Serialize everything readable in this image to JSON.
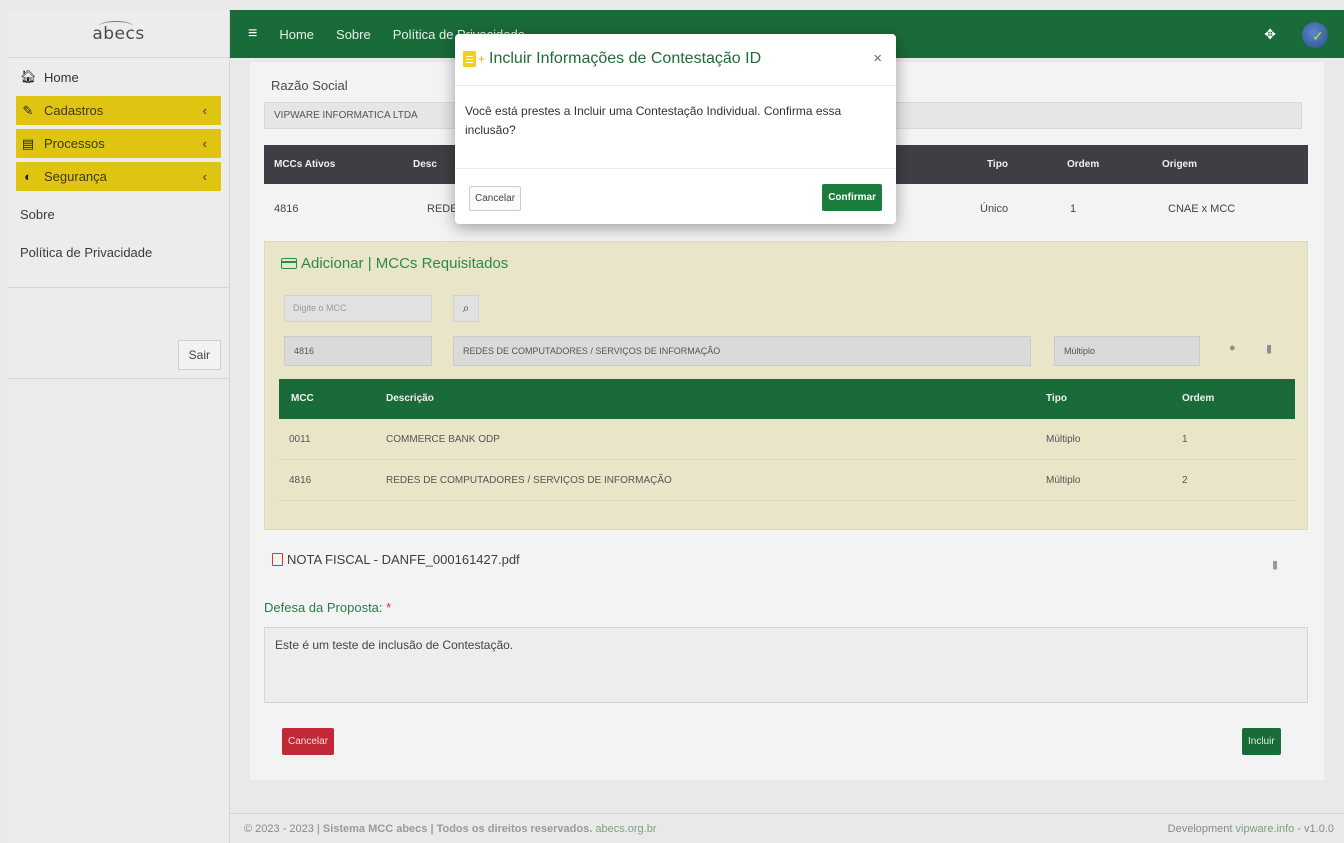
{
  "sidebar": {
    "brand": "abecs",
    "home": "Home",
    "menus": [
      {
        "label": "Cadastros"
      },
      {
        "label": "Processos"
      },
      {
        "label": "Segurança"
      }
    ],
    "sobre": "Sobre",
    "privacidade": "Política de Privacidade",
    "sair": "Sair"
  },
  "topbar": {
    "links": [
      "Home",
      "Sobre",
      "Política de Privacidade"
    ]
  },
  "form": {
    "razao_label": "Razão Social",
    "razao_value": "VIPWARE INFORMATICA LTDA",
    "active_table": {
      "headers": [
        "MCCs Ativos",
        "Desc",
        "Tipo",
        "Ordem",
        "Origem"
      ],
      "row": [
        "4816",
        "REDE",
        "Único",
        "1",
        "CNAE x MCC"
      ]
    },
    "mcc_panel": {
      "title": "Adicionar | MCCs Requisitados",
      "search_placeholder": "Digite o MCC",
      "code_value": "4816",
      "desc_value": "REDES DE COMPUTADORES / SERVIÇOS DE INFORMAÇÃO",
      "tipo_value": "Múltiplo",
      "headers": [
        "MCC",
        "Descrição",
        "Tipo",
        "Ordem"
      ],
      "rows": [
        [
          "0011",
          "COMMERCE BANK ODP",
          "Múltiplo",
          "1"
        ],
        [
          "4816",
          "REDES DE COMPUTADORES / SERVIÇOS DE INFORMAÇÃO",
          "Múltiplo",
          "2"
        ]
      ]
    },
    "attachment": "NOTA FISCAL - DANFE_000161427.pdf",
    "defesa_label": "Defesa da Proposta:",
    "defesa_required": "*",
    "defesa_text": "Este é um teste de inclusão de Contestação.",
    "cancel_label": "Cancelar",
    "incluir_label": "Incluir"
  },
  "footer": {
    "left_prefix": "© 2023 - 2023 |",
    "left_bold": "Sistema MCC abecs | Todos os direitos reservados.",
    "left_link": "abecs.org.br",
    "right_prefix": "Development",
    "right_link": "vipware.info",
    "right_version": "- v1.0.0"
  },
  "modal": {
    "title": "Incluir Informações de Contestação ID",
    "close": "×",
    "body": "Você está prestes a Incluir uma Contestação Individual. Confirma essa inclusão?",
    "cancel": "Cancelar",
    "confirm": "Confirmar"
  },
  "colors": {
    "primary_green": "#1a6b3a",
    "menu_yellow": "#e0c412",
    "danger_red": "#c02935",
    "table_dark": "#3d3f44",
    "panel_tan": "#e8e5c9"
  },
  "icons": [
    "home-icon",
    "edit-icon",
    "server-icon",
    "shield-icon",
    "chevron-left-icon",
    "hamburger-icon",
    "fullscreen-icon",
    "search-icon",
    "plus-circle-icon",
    "trash-icon",
    "pdf-icon",
    "file-plus-icon",
    "close-icon",
    "card-icon"
  ]
}
